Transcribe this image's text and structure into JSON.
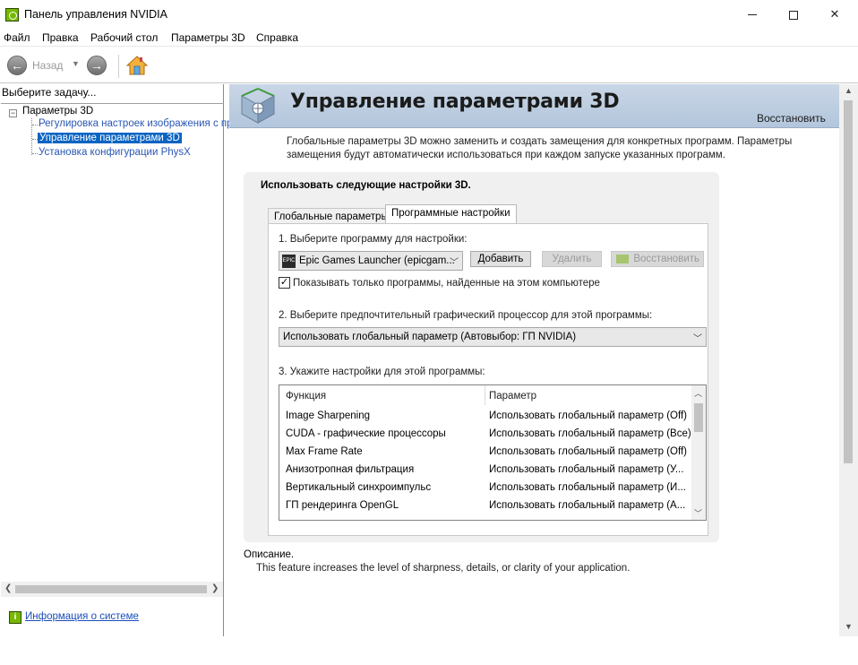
{
  "window": {
    "title": "Панель управления NVIDIA",
    "controls": {
      "minimize": "minimize",
      "maximize": "maximize",
      "close": "✕"
    }
  },
  "menu": [
    "Файл",
    "Правка",
    "Рабочий стол",
    "Параметры 3D",
    "Справка"
  ],
  "toolbar": {
    "back_label": "Назад",
    "back_icon": "arrow-left-icon",
    "forward_icon": "arrow-right-icon",
    "home_icon": "home-icon"
  },
  "sidebar": {
    "header": "Выберите задачу...",
    "root": {
      "expander": "−",
      "label": "Параметры 3D"
    },
    "items": [
      {
        "label": "Регулировка настроек изображения с пр",
        "selected": false
      },
      {
        "label": "Управление параметрами 3D",
        "selected": true
      },
      {
        "label": "Установка конфигурации PhysX",
        "selected": false
      }
    ],
    "system_info": "Информация о системе"
  },
  "page": {
    "title": "Управление параметрами 3D",
    "restore": "Восстановить",
    "intro": "Глобальные параметры 3D можно заменить и создать замещения для конкретных программ. Параметры замещения будут автоматически использоваться при каждом запуске указанных программ.",
    "panel_title": "Использовать следующие настройки 3D.",
    "tabs": [
      {
        "label": "Глобальные параметры",
        "active": false
      },
      {
        "label": "Программные настройки",
        "active": true
      }
    ],
    "step1": "1. Выберите программу для настройки:",
    "program_selected": "Epic Games Launcher (epicgam...",
    "program_icon_text": "EPIC",
    "buttons": {
      "add": "Добавить",
      "delete": "Удалить",
      "restore": "Восстановить"
    },
    "checkbox": {
      "checked": true,
      "mark": "✓",
      "label": "Показывать только программы, найденные на этом компьютере"
    },
    "step2": "2. Выберите предпочтительный графический процессор для этой программы:",
    "gpu_selected": "Использовать глобальный параметр (Автовыбор: ГП NVIDIA)",
    "step3": "3. Укажите настройки для этой программы:",
    "table": {
      "columns": [
        "Функция",
        "Параметр"
      ],
      "rows": [
        [
          "Image Sharpening",
          "Использовать глобальный параметр (Off)"
        ],
        [
          "CUDA - графические процессоры",
          "Использовать глобальный параметр (Все)"
        ],
        [
          "Max Frame Rate",
          "Использовать глобальный параметр (Off)"
        ],
        [
          "Анизотропная фильтрация",
          "Использовать глобальный параметр (У..."
        ],
        [
          "Вертикальный синхроимпульс",
          "Использовать глобальный параметр (И..."
        ],
        [
          "ГП рендеринга OpenGL",
          "Использовать глобальный параметр (А..."
        ]
      ]
    },
    "description_title": "Описание.",
    "description": "This feature increases the level of sharpness, details, or clarity of your application."
  },
  "colors": {
    "accent": "#0a64c2",
    "nvidia_green": "#76b900",
    "link": "#1a4db8",
    "banner": "#c0d0e2"
  }
}
